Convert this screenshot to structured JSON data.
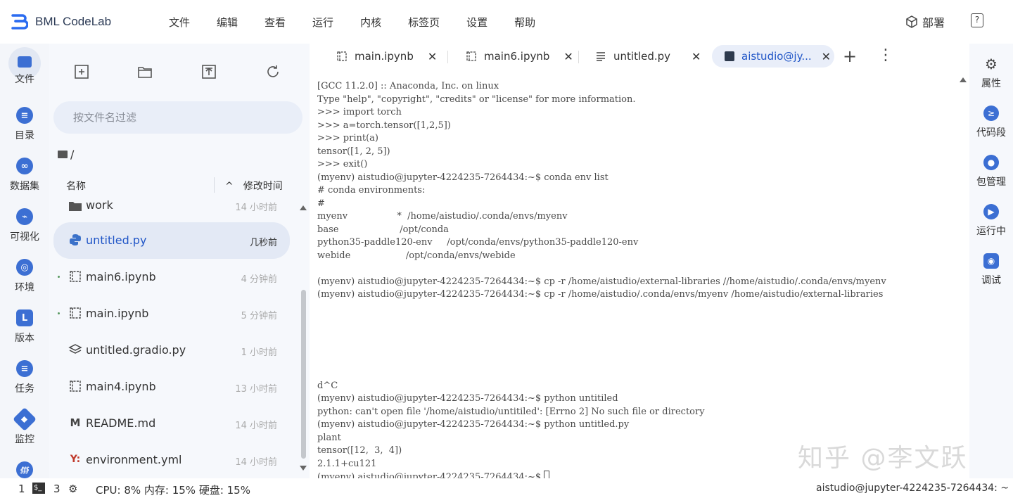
{
  "app": {
    "title": "BML CodeLab",
    "menu": [
      "文件",
      "编辑",
      "查看",
      "运行",
      "内核",
      "标签页",
      "设置",
      "帮助"
    ],
    "deploy_label": "部署",
    "help_label": "?"
  },
  "leftbar": {
    "items": [
      {
        "label": "文件",
        "icon": "folder-icon"
      },
      {
        "label": "目录",
        "icon": "toc-icon"
      },
      {
        "label": "数据集",
        "icon": "dataset-icon"
      },
      {
        "label": "可视化",
        "icon": "chart-icon"
      },
      {
        "label": "环境",
        "icon": "environment-icon"
      },
      {
        "label": "版本",
        "icon": "version-icon"
      },
      {
        "label": "任务",
        "icon": "task-icon"
      },
      {
        "label": "监控",
        "icon": "monitor-icon"
      }
    ]
  },
  "filepanel": {
    "filter_placeholder": "按文件名过滤",
    "breadcrumb": "/",
    "col_name": "名称",
    "col_sort_glyph": "^",
    "col_time": "修改时间",
    "files": [
      {
        "name": "work",
        "time": "14 小时前",
        "icon": "folder-icon",
        "selected": false,
        "dot": false
      },
      {
        "name": "untitled.py",
        "time": "几秒前",
        "icon": "python-icon",
        "selected": true,
        "dot": false
      },
      {
        "name": "main6.ipynb",
        "time": "4 分钟前",
        "icon": "notebook-icon",
        "selected": false,
        "dot": true
      },
      {
        "name": "main.ipynb",
        "time": "5 分钟前",
        "icon": "notebook-icon",
        "selected": false,
        "dot": true
      },
      {
        "name": "untitled.gradio.py",
        "time": "1 小时前",
        "icon": "gradio-icon",
        "selected": false,
        "dot": false
      },
      {
        "name": "main4.ipynb",
        "time": "13 小时前",
        "icon": "notebook-icon",
        "selected": false,
        "dot": false
      },
      {
        "name": "README.md",
        "time": "14 小时前",
        "icon": "markdown-icon",
        "selected": false,
        "dot": false
      },
      {
        "name": "environment.yml",
        "time": "14 小时前",
        "icon": "yaml-icon",
        "selected": false,
        "dot": false
      }
    ]
  },
  "tabs": [
    {
      "label": "main.ipynb",
      "icon": "notebook-icon",
      "active": false
    },
    {
      "label": "main6.ipynb",
      "icon": "notebook-icon",
      "active": false
    },
    {
      "label": "untitled.py",
      "icon": "text-file-icon",
      "active": false
    },
    {
      "label": "aistudio@jy...",
      "icon": "terminal-icon",
      "active": true
    }
  ],
  "tab_close_glyph": "✕",
  "terminal": {
    "lines": [
      "[GCC 11.2.0] :: Anaconda, Inc. on linux",
      "Type \"help\", \"copyright\", \"credits\" or \"license\" for more information.",
      ">>> import torch",
      ">>> a=torch.tensor([1,2,5])",
      ">>> print(a)",
      "tensor([1, 2, 5])",
      ">>> exit()",
      "(myenv) aistudio@jupyter-4224235-7264434:~$ conda env list",
      "# conda environments:",
      "#",
      "myenv                 *  /home/aistudio/.conda/envs/myenv",
      "base                     /opt/conda",
      "python35-paddle120-env     /opt/conda/envs/python35-paddle120-env",
      "webide                   /opt/conda/envs/webide",
      "",
      "(myenv) aistudio@jupyter-4224235-7264434:~$ cp -r /home/aistudio/external-libraries //home/aistudio/.conda/envs/myenv",
      "(myenv) aistudio@jupyter-4224235-7264434:~$ cp -r /home/aistudio/.conda/envs/myenv /home/aistudio/external-libraries",
      "",
      "",
      "",
      "",
      "",
      "",
      "d^C",
      "(myenv) aistudio@jupyter-4224235-7264434:~$ python untitiled",
      "python: can't open file '/home/aistudio/untitiled': [Errno 2] No such file or directory",
      "(myenv) aistudio@jupyter-4224235-7264434:~$ python untitled.py",
      "plant",
      "tensor([12,  3,  4])",
      "2.1.1+cu121",
      "(myenv) aistudio@jupyter-4224235-7264434:~$ "
    ],
    "watermark": "知乎 @李文跃"
  },
  "rightbar": {
    "items": [
      {
        "label": "属性",
        "icon": "gear-icon"
      },
      {
        "label": "代码段",
        "icon": "snippet-icon"
      },
      {
        "label": "包管理",
        "icon": "package-icon"
      },
      {
        "label": "运行中",
        "icon": "play-icon"
      },
      {
        "label": "调试",
        "icon": "debug-icon"
      }
    ]
  },
  "statusbar": {
    "kernel_count": "1",
    "terminal_count": "3",
    "stats": "CPU:  8% 内存:  15% 硬盘:  15%",
    "right_text": "aistudio@jupyter-4224235-7264434: ~"
  },
  "colors": {
    "accent": "#2156c7",
    "icon_blue": "#3c6fd3",
    "panel_bg": "#f6f8fc"
  }
}
